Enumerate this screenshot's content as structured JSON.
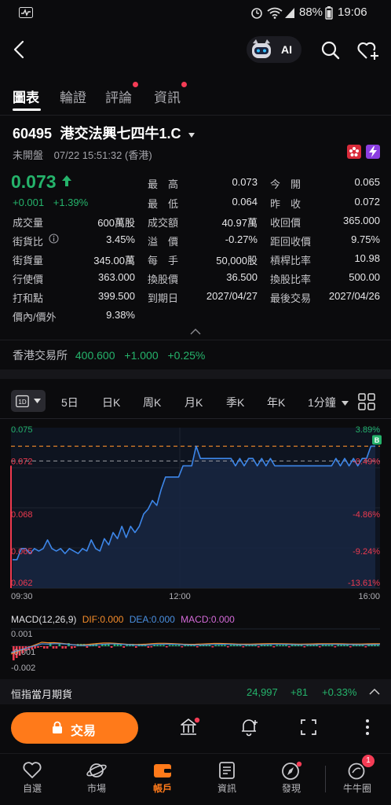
{
  "status_bar": {
    "battery": "88%",
    "time": "19:06"
  },
  "nav": {
    "ai_label": "AI"
  },
  "tabs": [
    {
      "label": "圖表",
      "active": true,
      "dot": false
    },
    {
      "label": "輪證",
      "active": false,
      "dot": false
    },
    {
      "label": "評論",
      "active": false,
      "dot": true
    },
    {
      "label": "資訊",
      "active": false,
      "dot": true
    }
  ],
  "stock": {
    "code": "60495",
    "name": "港交法興七四牛1.C",
    "market_status": "未開盤",
    "datetime": "07/22 15:51:32 (香港)",
    "price": "0.073",
    "change": "+0.001",
    "change_pct": "+1.39%"
  },
  "quote_grid": [
    {
      "label": "最　高",
      "value": "0.073",
      "color": "green"
    },
    {
      "label": "今　開",
      "value": "0.065",
      "color": "red"
    },
    {
      "label": "最　低",
      "value": "0.064",
      "color": "red"
    },
    {
      "label": "昨　收",
      "value": "0.072",
      "color": "normal"
    }
  ],
  "detail_rows": [
    [
      "成交量",
      "600萬股",
      "成交額",
      "40.97萬",
      "收回價",
      "365.000"
    ],
    [
      "街貨比",
      "3.45%",
      "溢　價",
      "-0.27%",
      "距回收價",
      "9.75%"
    ],
    [
      "街貨量",
      "345.00萬",
      "每　手",
      "50,000股",
      "槓桿比率",
      "10.98"
    ],
    [
      "行使價",
      "363.000",
      "換股價",
      "36.500",
      "換股比率",
      "500.00"
    ],
    [
      "打和點",
      "399.500",
      "到期日",
      "2027/04/27",
      "最後交易",
      "2027/04/26"
    ],
    [
      "價內/價外",
      "9.38%",
      "",
      "",
      "",
      ""
    ]
  ],
  "underlying": {
    "name": "香港交易所",
    "price": "400.600",
    "change": "+1.000",
    "change_pct": "+0.25%"
  },
  "periods": [
    "5日",
    "日K",
    "周K",
    "月K",
    "季K",
    "年K"
  ],
  "period_selected": "1D",
  "minute_select": "1分鐘",
  "chart_data": {
    "type": "line",
    "y_labels_left": [
      "0.075",
      "0.072",
      "0.068",
      "0.065",
      "0.062"
    ],
    "y_labels_right": [
      "3.89%",
      "-0.49%",
      "-4.86%",
      "-9.24%",
      "-13.61%"
    ],
    "x_labels": [
      "09:30",
      "12:00",
      "16:00"
    ],
    "ylim": [
      0.062,
      0.075
    ],
    "prev_close": 0.0723,
    "reference_dashed": 0.0735,
    "marker_label": "B",
    "series": [
      {
        "values": [
          0.0643,
          0.0643,
          0.0652,
          0.0652,
          0.0648,
          0.0652,
          0.065,
          0.0652,
          0.0659,
          0.0652,
          0.065,
          0.0652,
          0.0648,
          0.0652,
          0.065,
          0.0648,
          0.0652,
          0.065,
          0.0659,
          0.0652,
          0.065,
          0.066,
          0.0655,
          0.0665,
          0.066,
          0.067,
          0.0661,
          0.067,
          0.0665,
          0.067,
          0.068,
          0.0684,
          0.0691,
          0.0687,
          0.07,
          0.071,
          0.071,
          0.071,
          0.071,
          0.0719,
          0.0719,
          0.0719,
          0.0735,
          0.0725,
          0.0725,
          0.0725,
          0.0725,
          0.0725,
          0.0725,
          0.0725,
          0.0725,
          0.0719,
          0.0725,
          0.0719,
          0.0725,
          0.0725,
          0.0719,
          0.0725,
          0.0719,
          0.0725,
          0.0719,
          0.0719,
          0.0719,
          0.0719,
          0.0719,
          0.0719,
          0.0719,
          0.0719,
          0.0719,
          0.0719,
          0.0719,
          0.0719,
          0.0719,
          0.0719,
          0.0725,
          0.0719,
          0.0725,
          0.0719,
          0.0725,
          0.0719,
          0.0725,
          0.0725,
          0.0735,
          0.0735
        ]
      }
    ]
  },
  "macd": {
    "label": "MACD(12,26,9)",
    "dif": "DIF:0.000",
    "dea": "DEA:0.000",
    "macd": "MACD:0.000",
    "y_labels": [
      "0.001",
      "-0.001",
      "-0.002"
    ]
  },
  "ticker": {
    "name": "恒指當月期貨",
    "price": "24,997",
    "change": "+81",
    "change_pct": "+0.33%"
  },
  "trade_button": "交易",
  "bottom_nav": [
    {
      "label": "自選",
      "icon": "heart-icon"
    },
    {
      "label": "市場",
      "icon": "planet-icon"
    },
    {
      "label": "帳戶",
      "icon": "wallet-icon",
      "active": true
    },
    {
      "label": "資訊",
      "icon": "news-icon"
    },
    {
      "label": "發現",
      "icon": "compass-icon"
    },
    {
      "label": "牛牛圈",
      "icon": "community-icon",
      "badge": "1"
    }
  ]
}
